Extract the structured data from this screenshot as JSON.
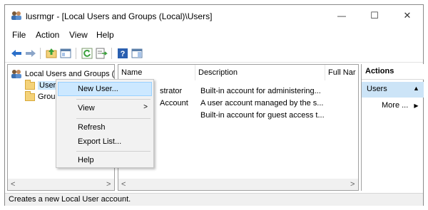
{
  "window": {
    "title": "lusrmgr - [Local Users and Groups (Local)\\Users]",
    "minimize_glyph": "—",
    "maximize_glyph": "☐",
    "close_glyph": "✕"
  },
  "menubar": {
    "file": "File",
    "action": "Action",
    "view": "View",
    "help": "Help"
  },
  "toolbar": {
    "icons": [
      "back-arrow-icon",
      "forward-arrow-icon",
      "up-folder-icon",
      "show-hide-tree-icon",
      "refresh-icon",
      "export-list-icon",
      "help-icon",
      "show-hide-action-pane-icon"
    ]
  },
  "tree": {
    "root": "Local Users and Groups (",
    "users": "Users",
    "groups": "Group"
  },
  "list": {
    "headers": {
      "name": "Name",
      "description": "Description",
      "fullname": "Full Nar"
    },
    "rows": [
      {
        "name": "strator",
        "description": "Built-in account for administering..."
      },
      {
        "name": "Account",
        "description": "A user account managed by the s..."
      },
      {
        "name": "",
        "description": "Built-in account for guest access t..."
      }
    ]
  },
  "actions": {
    "header": "Actions",
    "group": "Users",
    "group_arrow": "▲",
    "more": "More ...",
    "more_arrow": "▶"
  },
  "context_menu": {
    "new_user": "New User...",
    "view": "View",
    "view_arrow": ">",
    "refresh": "Refresh",
    "export_list": "Export List...",
    "help": "Help"
  },
  "scroll": {
    "left": "<",
    "right": ">"
  },
  "status": {
    "text": "Creates a new Local User account."
  },
  "colors": {
    "selection": "#cce8ff",
    "actions_group": "#cce4f7",
    "toolbar_blue": "#2a6fc9",
    "toolbar_green": "#3aa13a"
  }
}
